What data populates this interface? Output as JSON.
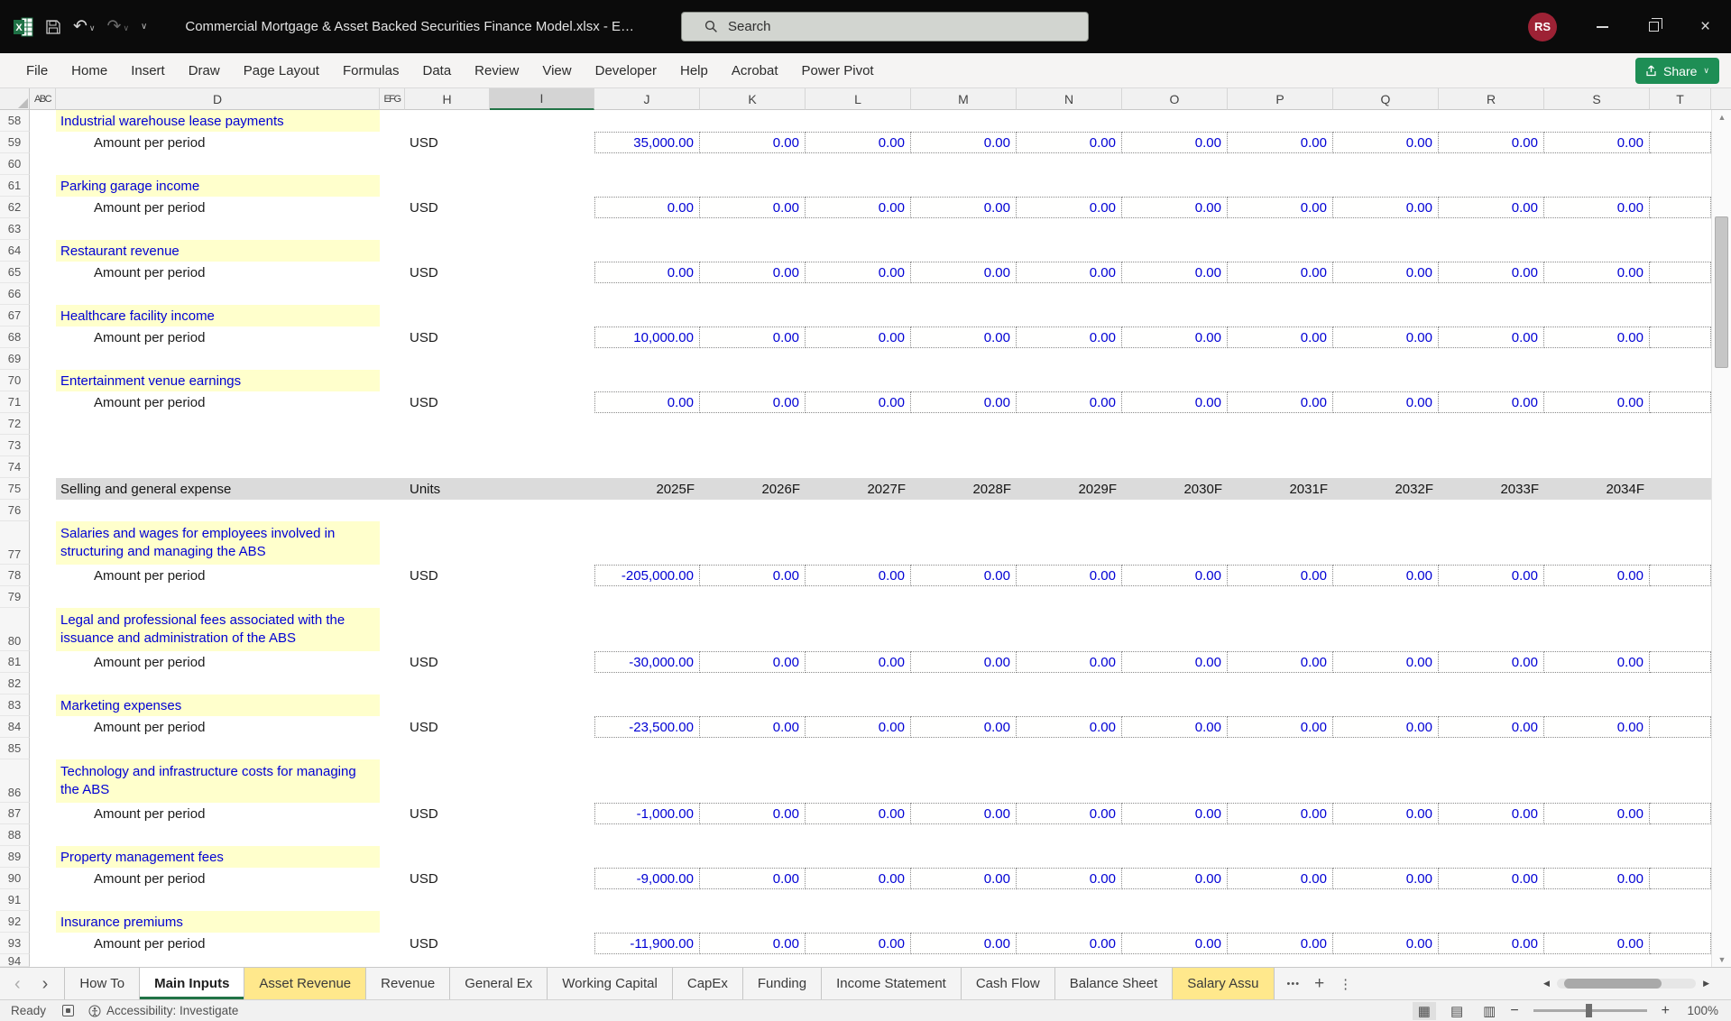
{
  "colors": {
    "accent_green": "#217346",
    "share_green": "#1E8E55",
    "input_yellow": "#FFFFCC",
    "input_blue": "#0000D4",
    "tab_yellow": "#FFE88C",
    "avatar_red": "#9D2235",
    "section_gray": "#DBDBDB"
  },
  "icons": {
    "undo": "↶",
    "redo": "↷",
    "dropdown_chevron": "∨",
    "close": "×",
    "prev_sheets": "‹",
    "next_sheets": "›",
    "more_sheets": "•••",
    "add_sheet": "+",
    "sheet_menu": "⋮",
    "hscroll_left": "◀",
    "hscroll_right": "▶",
    "vscroll_up": "▲",
    "vscroll_down": "▼",
    "zoom_out": "−",
    "zoom_in": "+",
    "view_normal": "▦",
    "view_page_layout": "▤",
    "view_page_break": "▥"
  },
  "titlebar": {
    "title": "Commercial Mortgage & Asset Backed Securities Finance Model.xlsx  -  E…",
    "search_placeholder": "Search",
    "avatar": "RS"
  },
  "ribbon": {
    "tabs": [
      "File",
      "Home",
      "Insert",
      "Draw",
      "Page Layout",
      "Formulas",
      "Data",
      "Review",
      "View",
      "Developer",
      "Help",
      "Acrobat",
      "Power Pivot"
    ],
    "share_label": "Share"
  },
  "grid": {
    "columns": [
      "ABC",
      "D",
      "EFG",
      "H",
      "I",
      "J",
      "K",
      "L",
      "M",
      "N",
      "O",
      "P",
      "Q",
      "R",
      "S",
      "T"
    ],
    "selected_column": "I",
    "rows": [
      {
        "num": 58,
        "type": "label",
        "text": "Industrial warehouse lease payments"
      },
      {
        "num": 59,
        "type": "data",
        "label": "Amount per period",
        "unit": "USD",
        "values": [
          "35,000.00",
          "0.00",
          "0.00",
          "0.00",
          "0.00",
          "0.00",
          "0.00",
          "0.00",
          "0.00",
          "0.00"
        ]
      },
      {
        "num": 60,
        "type": "empty"
      },
      {
        "num": 61,
        "type": "label",
        "text": "Parking garage income"
      },
      {
        "num": 62,
        "type": "data",
        "label": "Amount per period",
        "unit": "USD",
        "values": [
          "0.00",
          "0.00",
          "0.00",
          "0.00",
          "0.00",
          "0.00",
          "0.00",
          "0.00",
          "0.00",
          "0.00"
        ]
      },
      {
        "num": 63,
        "type": "empty"
      },
      {
        "num": 64,
        "type": "label",
        "text": "Restaurant revenue"
      },
      {
        "num": 65,
        "type": "data",
        "label": "Amount per period",
        "unit": "USD",
        "values": [
          "0.00",
          "0.00",
          "0.00",
          "0.00",
          "0.00",
          "0.00",
          "0.00",
          "0.00",
          "0.00",
          "0.00"
        ]
      },
      {
        "num": 66,
        "type": "empty"
      },
      {
        "num": 67,
        "type": "label",
        "text": "Healthcare facility income"
      },
      {
        "num": 68,
        "type": "data",
        "label": "Amount per period",
        "unit": "USD",
        "values": [
          "10,000.00",
          "0.00",
          "0.00",
          "0.00",
          "0.00",
          "0.00",
          "0.00",
          "0.00",
          "0.00",
          "0.00"
        ]
      },
      {
        "num": 69,
        "type": "empty"
      },
      {
        "num": 70,
        "type": "label",
        "text": "Entertainment venue earnings"
      },
      {
        "num": 71,
        "type": "data",
        "label": "Amount per period",
        "unit": "USD",
        "values": [
          "0.00",
          "0.00",
          "0.00",
          "0.00",
          "0.00",
          "0.00",
          "0.00",
          "0.00",
          "0.00",
          "0.00"
        ]
      },
      {
        "num": 72,
        "type": "empty"
      },
      {
        "num": 73,
        "type": "empty"
      },
      {
        "num": 74,
        "type": "empty"
      },
      {
        "num": 75,
        "type": "section",
        "title": "Selling and general expense",
        "unit_header": "Units",
        "years": [
          "2025F",
          "2026F",
          "2027F",
          "2028F",
          "2029F",
          "2030F",
          "2031F",
          "2032F",
          "2033F",
          "2034F"
        ]
      },
      {
        "num": 76,
        "type": "empty"
      },
      {
        "num": 77,
        "type": "label",
        "tall": true,
        "text": "Salaries and wages for employees involved in structuring and managing the ABS"
      },
      {
        "num": 78,
        "type": "data",
        "label": "Amount per period",
        "unit": "USD",
        "values": [
          "-205,000.00",
          "0.00",
          "0.00",
          "0.00",
          "0.00",
          "0.00",
          "0.00",
          "0.00",
          "0.00",
          "0.00"
        ]
      },
      {
        "num": 79,
        "type": "empty"
      },
      {
        "num": 80,
        "type": "label",
        "tall": true,
        "text": "Legal and professional fees associated with the issuance and administration of the ABS"
      },
      {
        "num": 81,
        "type": "data",
        "label": "Amount per period",
        "unit": "USD",
        "values": [
          "-30,000.00",
          "0.00",
          "0.00",
          "0.00",
          "0.00",
          "0.00",
          "0.00",
          "0.00",
          "0.00",
          "0.00"
        ]
      },
      {
        "num": 82,
        "type": "empty"
      },
      {
        "num": 83,
        "type": "label",
        "text": "Marketing expenses"
      },
      {
        "num": 84,
        "type": "data",
        "label": "Amount per period",
        "unit": "USD",
        "values": [
          "-23,500.00",
          "0.00",
          "0.00",
          "0.00",
          "0.00",
          "0.00",
          "0.00",
          "0.00",
          "0.00",
          "0.00"
        ]
      },
      {
        "num": 85,
        "type": "empty"
      },
      {
        "num": 86,
        "type": "label",
        "tall": true,
        "text": "Technology and infrastructure costs for managing the ABS"
      },
      {
        "num": 87,
        "type": "data",
        "label": "Amount per period",
        "unit": "USD",
        "values": [
          "-1,000.00",
          "0.00",
          "0.00",
          "0.00",
          "0.00",
          "0.00",
          "0.00",
          "0.00",
          "0.00",
          "0.00"
        ]
      },
      {
        "num": 88,
        "type": "empty"
      },
      {
        "num": 89,
        "type": "label",
        "text": "Property management fees"
      },
      {
        "num": 90,
        "type": "data",
        "label": "Amount per period",
        "unit": "USD",
        "values": [
          "-9,000.00",
          "0.00",
          "0.00",
          "0.00",
          "0.00",
          "0.00",
          "0.00",
          "0.00",
          "0.00",
          "0.00"
        ]
      },
      {
        "num": 91,
        "type": "empty"
      },
      {
        "num": 92,
        "type": "label",
        "text": "Insurance premiums"
      },
      {
        "num": 93,
        "type": "data",
        "label": "Amount per period",
        "unit": "USD",
        "values": [
          "-11,900.00",
          "0.00",
          "0.00",
          "0.00",
          "0.00",
          "0.00",
          "0.00",
          "0.00",
          "0.00",
          "0.00"
        ]
      },
      {
        "num": 94,
        "type": "empty",
        "partial": true
      }
    ]
  },
  "sheet_tabs": [
    {
      "label": "How To",
      "style": "normal"
    },
    {
      "label": "Main Inputs",
      "style": "active"
    },
    {
      "label": "Asset Revenue",
      "style": "yellow"
    },
    {
      "label": "Revenue",
      "style": "normal"
    },
    {
      "label": "General Ex",
      "style": "normal"
    },
    {
      "label": "Working Capital",
      "style": "normal"
    },
    {
      "label": "CapEx",
      "style": "normal"
    },
    {
      "label": "Funding",
      "style": "normal"
    },
    {
      "label": "Income Statement",
      "style": "normal"
    },
    {
      "label": "Cash Flow",
      "style": "normal"
    },
    {
      "label": "Balance Sheet",
      "style": "normal"
    },
    {
      "label": "Salary Assu",
      "style": "yellow"
    }
  ],
  "status_bar": {
    "mode": "Ready",
    "accessibility": "Accessibility: Investigate",
    "zoom_level": "100%"
  }
}
